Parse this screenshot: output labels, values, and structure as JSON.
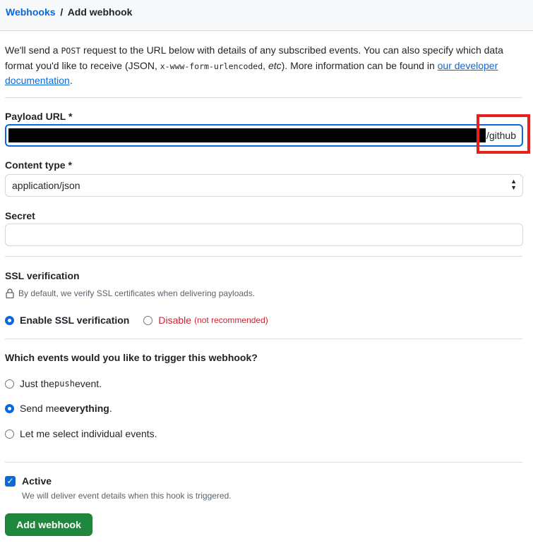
{
  "breadcrumb": {
    "parent": "Webhooks",
    "separator": "/",
    "current": "Add webhook"
  },
  "intro": {
    "part1": "We'll send a ",
    "code1": "POST",
    "part2": " request to the URL below with details of any subscribed events. You can also specify which data format you'd like to receive (JSON, ",
    "code2": "x-www-form-urlencoded",
    "part3": ", ",
    "etc": "etc",
    "part4": "). More information can be found in ",
    "link": "our developer documentation",
    "part5": "."
  },
  "payload_url": {
    "label": "Payload URL *",
    "visible_suffix": "/github"
  },
  "content_type": {
    "label": "Content type *",
    "selected": "application/json"
  },
  "secret": {
    "label": "Secret",
    "value": ""
  },
  "ssl": {
    "title": "SSL verification",
    "note": "By default, we verify SSL certificates when delivering payloads.",
    "enable_label": "Enable SSL verification",
    "disable_label": "Disable",
    "disable_note": "(not recommended)"
  },
  "events": {
    "question": "Which events would you like to trigger this webhook?",
    "opt1_pre": "Just the ",
    "opt1_code": "push",
    "opt1_post": " event.",
    "opt2_pre": "Send me ",
    "opt2_bold": "everything",
    "opt2_post": ".",
    "opt3": "Let me select individual events."
  },
  "active": {
    "label": "Active",
    "description": "We will deliver event details when this hook is triggered."
  },
  "submit_label": "Add webhook"
}
